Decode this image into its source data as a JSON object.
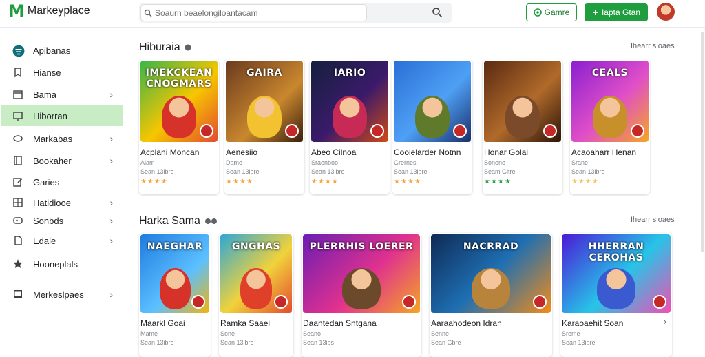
{
  "header": {
    "logo_mark": "M",
    "logo_text": "Markeyplace",
    "search_placeholder": "Soaurn beaelongiloantacam",
    "game_button": "Gamre",
    "primary_button": "Iapta Gtan",
    "brand_color": "#1e9e3e"
  },
  "sidebar": {
    "items": [
      {
        "label": "Apibanas",
        "icon": "shield-icon",
        "chevron": false
      },
      {
        "label": "Hianse",
        "icon": "bookmark-icon",
        "chevron": false
      },
      {
        "label": "Bama",
        "icon": "calendar-icon",
        "chevron": true
      },
      {
        "label": "Hiborran",
        "icon": "monitor-icon",
        "chevron": false
      },
      {
        "label": "Markabas",
        "icon": "tag-icon",
        "chevron": true
      },
      {
        "label": "Bookaher",
        "icon": "book-icon",
        "chevron": true
      },
      {
        "label": "Garies",
        "icon": "edit-icon",
        "chevron": false
      },
      {
        "label": "Hatidiooe",
        "icon": "grid-icon",
        "chevron": true
      },
      {
        "label": "Sonbds",
        "icon": "gamepad-icon",
        "chevron": true
      },
      {
        "label": "Edale",
        "icon": "document-icon",
        "chevron": true
      },
      {
        "label": "Hooneplals",
        "icon": "star-icon",
        "chevron": false
      },
      {
        "label": "Merkeslpaes",
        "icon": "laptop-icon",
        "chevron": true
      }
    ]
  },
  "sections": [
    {
      "title": "Hiburaia",
      "see_all": "Ihearr sloaes",
      "cards": [
        {
          "thumb_title": "IMEKCKEAN CNOGMARS",
          "name": "Acplani Moncan",
          "line1": "Alam",
          "line2": "Sean 13ibre",
          "rating": 4,
          "star_color": "#f2a33a"
        },
        {
          "thumb_title": "GAIRA",
          "name": "Aenesiio",
          "line1": "Dame",
          "line2": "Sean 13ibre",
          "rating": 4,
          "star_color": "#f2a33a"
        },
        {
          "thumb_title": "IARIO",
          "name": "Abeo Cilnoa",
          "line1": "Sraenboo",
          "line2": "Sean 13lbre",
          "rating": 4,
          "star_color": "#f2a33a"
        },
        {
          "thumb_title": "",
          "name": "Coolelarder Notnn",
          "line1": "Grernes",
          "line2": "Sean 13ibre",
          "rating": 4,
          "star_color": "#f2a33a"
        },
        {
          "thumb_title": "",
          "name": "Honar Golai",
          "line1": "Sonene",
          "line2": "Seam Gltre",
          "rating": 4,
          "star_color": "#2e9e4e"
        },
        {
          "thumb_title": "CEALS",
          "name": "Acaoaharr Henan",
          "line1": "Srane",
          "line2": "Sean 13ibre",
          "rating": 4,
          "star_color": "#f2c45a"
        }
      ]
    },
    {
      "title": "Harka Sama",
      "see_all": "Ihearr sloaes",
      "cards": [
        {
          "thumb_title": "NAEGHAR",
          "name": "Maarkl Goai",
          "line1": "Mame",
          "line2": "Sean 13ibre"
        },
        {
          "thumb_title": "GNGHAS",
          "name": "Ramka Saaei",
          "line1": "Sone",
          "line2": "Sean 13ibre"
        },
        {
          "thumb_title": "PLERRHIS LOERER",
          "name": "Daantedan Sntgana",
          "line1": "Seano",
          "line2": "Sean 13ibs"
        },
        {
          "thumb_title": "NACRRAD",
          "name": "Aaraahodeon Idran",
          "line1": "Senne",
          "line2": "Sean Gbre"
        },
        {
          "thumb_title": "HHERRAN CEROHAS",
          "name": "Karaoaehit Soan",
          "line1": "Sreme",
          "line2": "Sean 13ibre"
        }
      ]
    }
  ]
}
